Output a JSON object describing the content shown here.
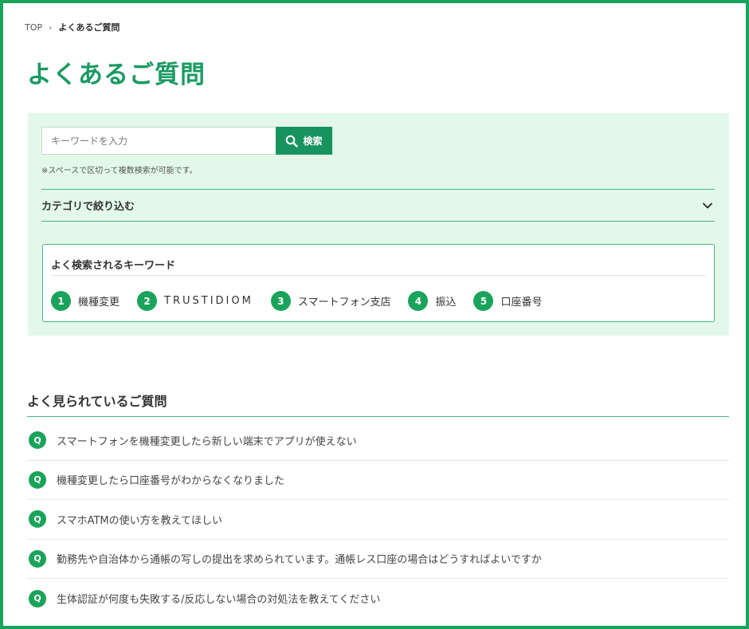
{
  "breadcrumb": {
    "home": "TOP",
    "separator": "›",
    "current": "よくあるご質問"
  },
  "page": {
    "title": "よくあるご質問"
  },
  "search": {
    "placeholder": "キーワードを入力",
    "button_label": "検索",
    "note": "※スペースで区切って複数検索が可能です。",
    "icon": "search-icon"
  },
  "category": {
    "label": "カテゴリで絞り込む",
    "icon": "chevron-down-icon"
  },
  "popular_keywords": {
    "title": "よく検索されるキーワード",
    "items": [
      {
        "rank": "1",
        "label": "機種変更"
      },
      {
        "rank": "2",
        "label": "TRUSTIDIOM"
      },
      {
        "rank": "3",
        "label": "スマートフォン支店"
      },
      {
        "rank": "4",
        "label": "振込"
      },
      {
        "rank": "5",
        "label": "口座番号"
      }
    ]
  },
  "faq": {
    "title": "よく見られているご質問",
    "badge": "Q",
    "items": [
      "スマートフォンを機種変更したら新しい端末でアプリが使えない",
      "機種変更したら口座番号がわからなくなりました",
      "スマホATMの使い方を教えてほしい",
      "勤務先や自治体から通帳の写しの提出を求められています。通帳レス口座の場合はどうすればよいですか",
      "生体認証が何度も失敗する/反応しない場合の対処法を教えてください"
    ]
  },
  "colors": {
    "accent": "#1aa35b",
    "title_green": "#1a9a62",
    "panel_bg": "#e3f8e9",
    "frame": "#1aa35b"
  }
}
